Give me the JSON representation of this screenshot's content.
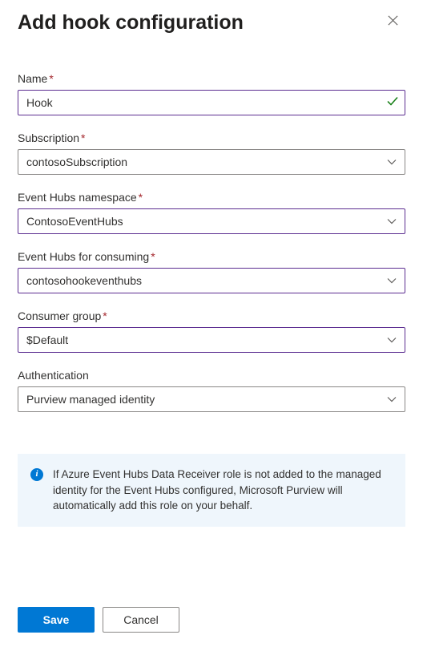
{
  "header": {
    "title": "Add hook configuration"
  },
  "fields": {
    "name": {
      "label": "Name",
      "required": true,
      "value": "Hook",
      "validated": true
    },
    "subscription": {
      "label": "Subscription",
      "required": true,
      "value": "contosoSubscription"
    },
    "namespace": {
      "label": "Event Hubs namespace",
      "required": true,
      "value": "ContosoEventHubs"
    },
    "consuming": {
      "label": "Event Hubs for consuming",
      "required": true,
      "value": "contosohookeventhubs"
    },
    "consumerGroup": {
      "label": "Consumer group",
      "required": true,
      "value": "$Default"
    },
    "authentication": {
      "label": "Authentication",
      "required": false,
      "value": "Purview managed identity"
    }
  },
  "info": {
    "message": "If Azure Event Hubs Data Receiver role is not added to the managed identity for the Event Hubs configured, Microsoft Purview will automatically add this role on your behalf."
  },
  "footer": {
    "save": "Save",
    "cancel": "Cancel"
  }
}
